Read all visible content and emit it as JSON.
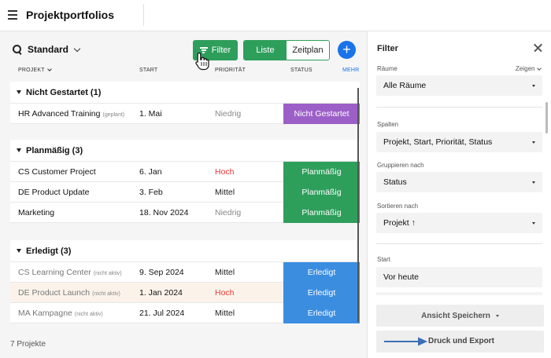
{
  "app": {
    "title": "Projektportfolios"
  },
  "toolbar": {
    "view_name": "Standard",
    "filter_label": "Filter",
    "list_label": "Liste",
    "timeline_label": "Zeitplan",
    "add_label": "+"
  },
  "columns": {
    "project": "PROJEKT",
    "start": "START",
    "priority": "PRIORITÄT",
    "status": "STATUS",
    "more": "MEHR"
  },
  "groups": [
    {
      "title": "Nicht Gestartet (1)",
      "rows": [
        {
          "name": "HR Advanced Training",
          "tag": "(geplant)",
          "start": "1. Mai",
          "priority": "Niedrig",
          "status": "Nicht Gestartet"
        }
      ]
    },
    {
      "title": "Planmäßig (3)",
      "rows": [
        {
          "name": "CS Customer Project",
          "tag": "",
          "start": "6. Jan",
          "priority": "Hoch",
          "status": "Planmäßig"
        },
        {
          "name": "DE Product Update",
          "tag": "",
          "start": "3. Feb",
          "priority": "Mittel",
          "status": "Planmäßig"
        },
        {
          "name": "Marketing",
          "tag": "",
          "start": "18. Nov 2024",
          "priority": "Niedrig",
          "status": "Planmäßig"
        }
      ]
    },
    {
      "title": "Erledigt (3)",
      "rows": [
        {
          "name": "CS Learning Center",
          "tag": "(nicht aktiv)",
          "start": "9. Sep 2024",
          "priority": "Mittel",
          "status": "Erledigt"
        },
        {
          "name": "DE Product Launch",
          "tag": "(nicht aktiv)",
          "start": "1. Jan 2024",
          "priority": "Hoch",
          "status": "Erledigt"
        },
        {
          "name": "MA Kampagne",
          "tag": "(nicht aktiv)",
          "start": "21. Jul 2024",
          "priority": "Mittel",
          "status": "Erledigt"
        }
      ]
    }
  ],
  "footer": {
    "count": "7 Projekte"
  },
  "filter_panel": {
    "title": "Filter",
    "rooms_label": "Räume",
    "show_label": "Zeigen",
    "rooms_value": "Alle Räume",
    "columns_label": "Spalten",
    "columns_value": "Projekt, Start, Priorität, Status",
    "group_label": "Gruppieren nach",
    "group_value": "Status",
    "sort_label": "Sortieren nach",
    "sort_value": "Projekt ↑",
    "start_label": "Start",
    "start_value": "Vor heute",
    "save_view_label": "Ansicht Speichern",
    "print_export_label": "Druck und Export"
  },
  "colors": {
    "accent_green": "#2e9e5b",
    "accent_blue": "#1a73e8",
    "status_not_started": "#9c5fc8",
    "status_on_track": "#2e9e5b",
    "status_done": "#3b8de0",
    "priority_high": "#e53935"
  },
  "icons": [
    "menu-icon",
    "search-icon",
    "chevron-down-icon",
    "filter-icon",
    "plus-icon",
    "close-icon",
    "pointer-cursor-icon",
    "arrow-right-icon"
  ]
}
